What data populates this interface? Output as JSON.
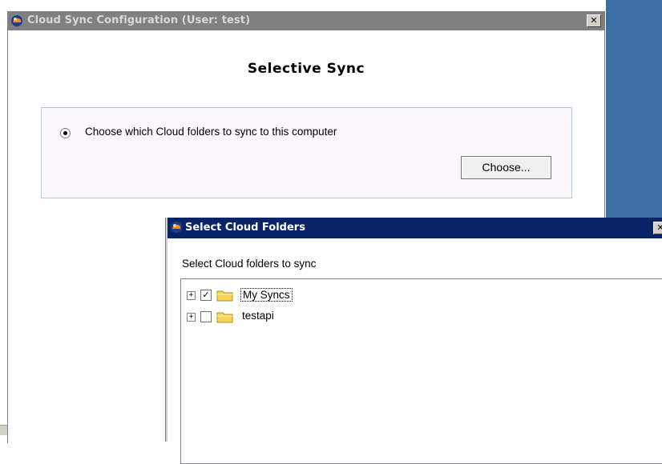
{
  "main_window": {
    "title": "Cloud Sync Configuration (User: test)",
    "close_glyph": "✕",
    "heading": "Selective Sync",
    "option": {
      "label": "Choose which Cloud folders to sync to this computer",
      "selected": true
    },
    "choose_button": "Choose..."
  },
  "dialog": {
    "title": "Select Cloud Folders",
    "close_glyph": "✕",
    "prompt": "Select Cloud folders to sync",
    "tree": [
      {
        "label": "My Syncs",
        "checked": true,
        "expander": "+",
        "icon": "folder-icon",
        "focused": true
      },
      {
        "label": "testapi",
        "checked": false,
        "expander": "+",
        "icon": "folder-icon",
        "focused": false
      }
    ]
  },
  "colors": {
    "inactive_titlebar": "#808080",
    "active_titlebar": "#0a246a",
    "panel_bg": "#fbf7fd",
    "panel_border": "#a8cde4",
    "desktop_blue": "#3a6ea5",
    "folder_yellow": "#f5d25c"
  }
}
